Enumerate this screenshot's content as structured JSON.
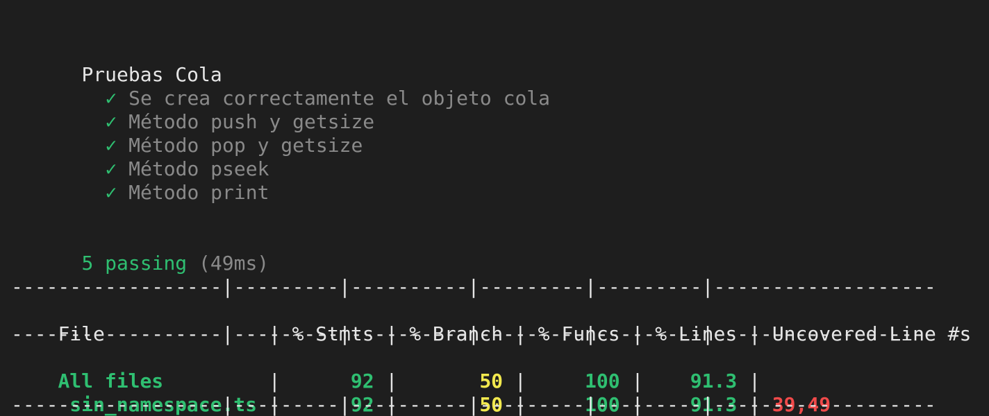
{
  "suite": {
    "title": "Pruebas Cola",
    "tests": [
      {
        "status": "✓",
        "title": "Se crea correctamente el objeto cola"
      },
      {
        "status": "✓",
        "title": "Método push y getsize"
      },
      {
        "status": "✓",
        "title": "Método pop y getsize"
      },
      {
        "status": "✓",
        "title": "Método pseek"
      },
      {
        "status": "✓",
        "title": "Método print"
      }
    ]
  },
  "summary": {
    "passing_label": "5 passing",
    "duration": "(49ms)"
  },
  "coverage": {
    "top_border": "------------------|---------|----------|---------|---------|-------------------",
    "headers": [
      "File",
      "% Stmts",
      "% Branch",
      "% Funcs",
      "% Lines",
      "Uncovered Line #s"
    ],
    "mid_border": "------------------|---------|----------|---------|---------|-------------------",
    "bottom_border": "------------------|---------|----------|---------|---------|-------------------",
    "rows": [
      {
        "file": "All files",
        "stmts": "92",
        "branch": "50",
        "funcs": "100",
        "lines": "91.3",
        "uncovered": ""
      },
      {
        "file": " sin_namespace.ts",
        "stmts": "92",
        "branch": "50",
        "funcs": "100",
        "lines": "91.3",
        "uncovered": "39,49"
      }
    ]
  },
  "colors": {
    "background": "#1e1e1e",
    "pass_green": "#2fbf71",
    "warn_yellow": "#f2e94e",
    "error_red": "#f04a4a",
    "dim_gray": "#8a8a8a"
  }
}
